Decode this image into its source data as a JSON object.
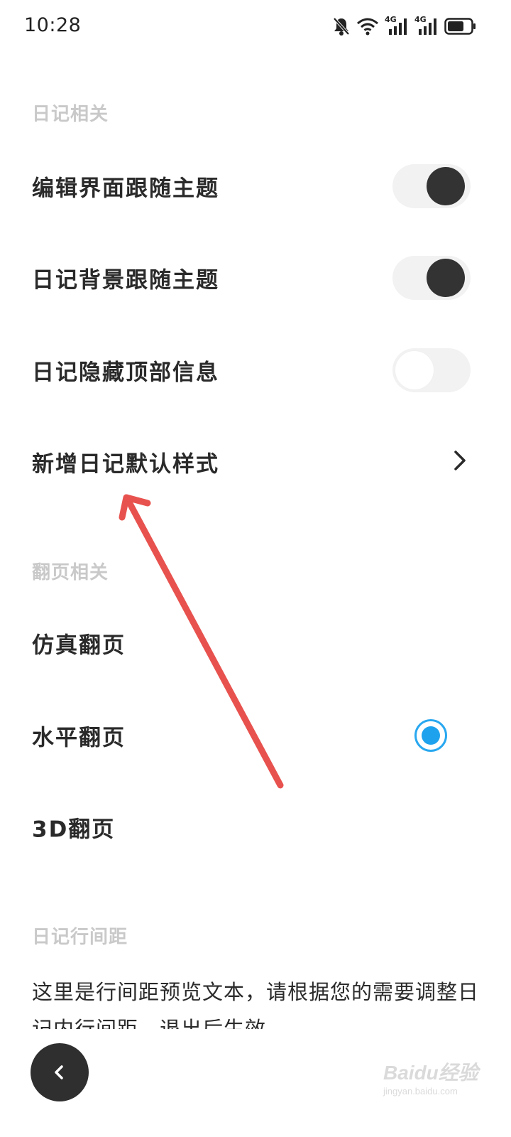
{
  "status_bar": {
    "time": "10:28",
    "icons": [
      "bell-muted-icon",
      "wifi-icon",
      "signal-4g-icon",
      "signal-4g-icon",
      "battery-icon"
    ],
    "network_label_1": "4G",
    "network_label_2": "4G"
  },
  "sections": {
    "diary": {
      "header": "日记相关",
      "items": [
        {
          "label": "编辑界面跟随主题",
          "control": "toggle",
          "on": true
        },
        {
          "label": "日记背景跟随主题",
          "control": "toggle",
          "on": true
        },
        {
          "label": "日记隐藏顶部信息",
          "control": "toggle",
          "on": false
        },
        {
          "label": "新增日记默认样式",
          "control": "chevron",
          "icon": "chevron-right-icon"
        }
      ]
    },
    "page_turn": {
      "header": "翻页相关",
      "items": [
        {
          "label": "仿真翻页",
          "selected": false
        },
        {
          "label": "水平翻页",
          "selected": true
        },
        {
          "label": "3D翻页",
          "selected": false
        }
      ]
    },
    "line_spacing": {
      "header": "日记行间距",
      "preview_text": "这里是行间距预览文本，请根据您的需要调整日记内行间距，退出后生效"
    }
  },
  "back_button": {
    "icon": "chevron-left-icon"
  },
  "colors": {
    "toggle_on_knob": "#333333",
    "toggle_track": "#f2f2f2",
    "radio_accent": "#1ea2ee",
    "annotation_arrow": "#e8524e",
    "section_header": "#c9c9c9"
  },
  "watermark": {
    "main": "Baidu经验",
    "sub": "jingyan.baidu.com"
  }
}
